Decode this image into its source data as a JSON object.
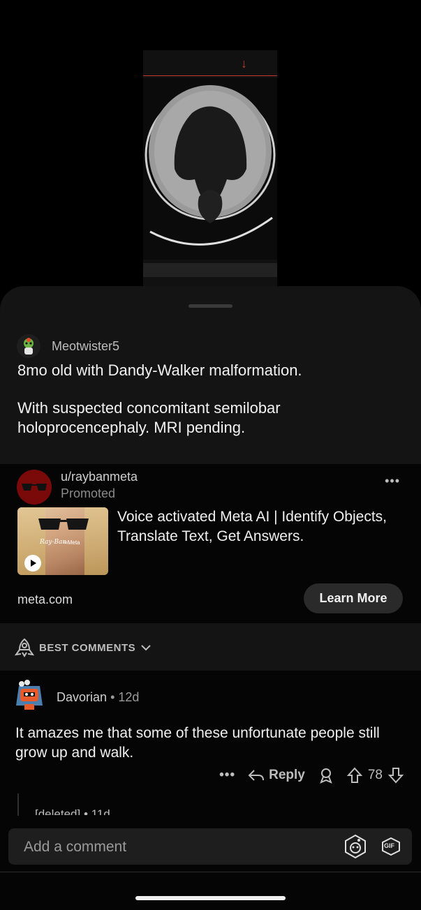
{
  "post": {
    "author": "Meotwister5",
    "title": "8mo old with Dandy-Walker malformation.",
    "body": "With suspected concomitant semilobar holoprocencephaly. MRI pending."
  },
  "ad": {
    "user": "u/raybanmeta",
    "promoted": "Promoted",
    "more": "•••",
    "headline": "Voice activated Meta AI | Identify Objects, Translate Text, Get Answers.",
    "domain": "meta.com",
    "cta": "Learn More",
    "thumb_brand": "Ray-Ban",
    "thumb_meta": "∞Meta"
  },
  "sort": {
    "label": "BEST COMMENTS"
  },
  "comment": {
    "author": "Davorian",
    "separator": "•",
    "age": "12d",
    "text": "It amazes me that some of these unfortunate people still grow up and walk.",
    "more": "•••",
    "reply_label": "Reply",
    "votes": "78"
  },
  "reply_preview": {
    "author": "[deleted]",
    "separator": "•",
    "age": "11d"
  },
  "composer": {
    "placeholder": "Add a comment",
    "gif_label": "GIF"
  },
  "icons": {
    "sort": "rocket-icon",
    "reply": "reply-arrow-icon",
    "award": "award-icon",
    "upvote": "upvote-arrow-icon",
    "downvote": "downvote-arrow-icon",
    "snoo": "snoo-emoji-icon",
    "gif": "gif-icon"
  },
  "colors": {
    "background": "#000000",
    "sheet": "#141414",
    "ad_avatar": "#7a0a0a",
    "button": "#2a2a2a"
  }
}
